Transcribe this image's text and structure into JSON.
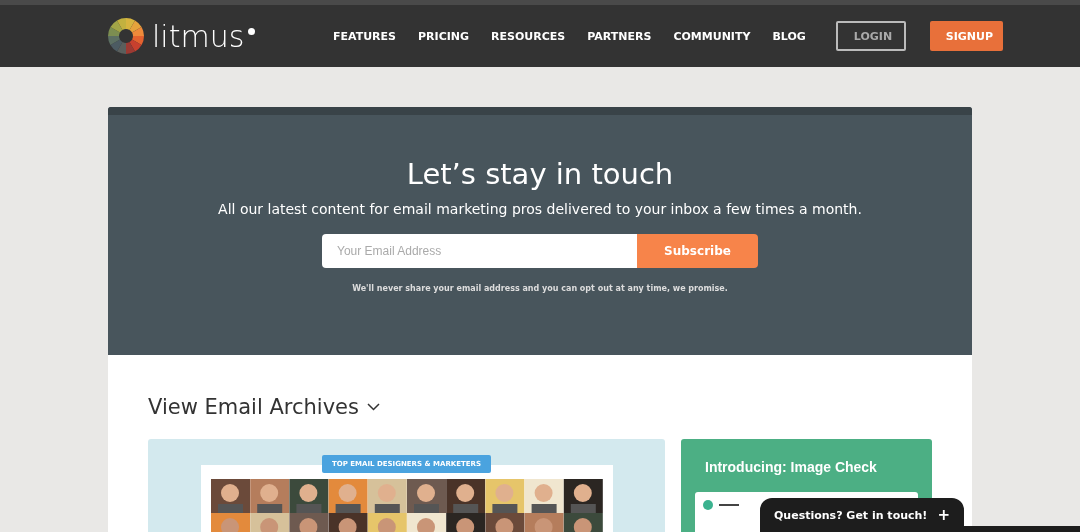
{
  "header": {
    "brand": "litmus",
    "nav": [
      {
        "label": "FEATURES"
      },
      {
        "label": "PRICING"
      },
      {
        "label": "RESOURCES"
      },
      {
        "label": "PARTNERS"
      },
      {
        "label": "COMMUNITY"
      },
      {
        "label": "BLOG"
      }
    ],
    "buttons": [
      {
        "kind": "outline",
        "label": "LOGIN"
      },
      {
        "kind": "filled",
        "label": "SIGNUP"
      }
    ]
  },
  "newsletter": {
    "title": "Let’s stay in touch",
    "subtitle": "All our latest content for email marketing pros delivered to your inbox a few times a month.",
    "email": {
      "placeholder": "Your Email Address"
    },
    "button": "Subscribe",
    "note": "We'll never share your email address and you can opt out at any time, we promise."
  },
  "archives": {
    "title": "View Email Archives",
    "cards": [
      {
        "kind": "community",
        "badge": "TOP EMAIL DESIGNERS & MARKETERS"
      },
      {
        "kind": "promo",
        "title": "Introducing: Image Check"
      }
    ]
  },
  "chat": {
    "label": "Questions? Get in touch!",
    "icon": "+"
  }
}
